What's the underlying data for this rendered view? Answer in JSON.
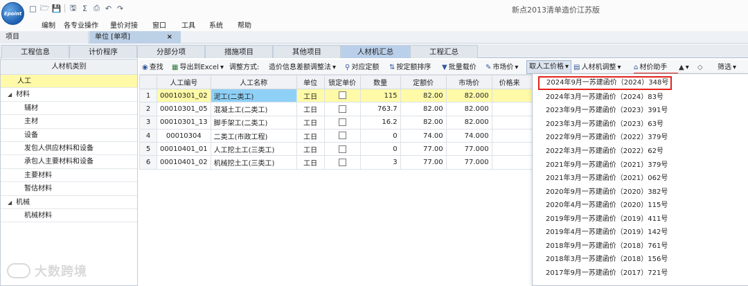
{
  "logo_text": "Epoint",
  "app_title": "新点2013清单造价江苏版",
  "menu": [
    "编制",
    "各专业操作",
    "量价对接",
    "窗口",
    "工具",
    "系统",
    "帮助"
  ],
  "doc_tabs": {
    "project": "项目",
    "unit": "单位 [单项]",
    "close": "×"
  },
  "feature_tabs": [
    "工程信息",
    "计价程序",
    "分部分项",
    "措施项目",
    "其他项目",
    "人材机汇总",
    "工程汇总"
  ],
  "left_panel": {
    "header": "人材机类别",
    "items": [
      {
        "label": "人工",
        "level": 0,
        "selected": true
      },
      {
        "label": "材料",
        "level": -1,
        "expanded": true
      },
      {
        "label": "辅材",
        "level": 1
      },
      {
        "label": "主材",
        "level": 1
      },
      {
        "label": "设备",
        "level": 1
      },
      {
        "label": "发包人供应材料和设备",
        "level": 1
      },
      {
        "label": "承包人主要材料和设备",
        "level": 1
      },
      {
        "label": "主要材料",
        "level": 1
      },
      {
        "label": "暂估材料",
        "level": 1
      },
      {
        "label": "机械",
        "level": -1,
        "expanded": true
      },
      {
        "label": "机械材料",
        "level": 1
      }
    ]
  },
  "toolbar": {
    "find": "查找",
    "export": "导出到Excel",
    "adjust_label": "调整方式:",
    "adjust_value": "造价信息差额调整法",
    "match_quota": "对应定额",
    "sort_quota": "按定额排序",
    "batch_price": "批量载价",
    "market_price": "市场价",
    "labor_price": "取人工价格",
    "rcj_adjust": "人材机调整",
    "price_helper": "材价助手",
    "filter": "筛选"
  },
  "grid": {
    "headers": [
      "",
      "人工编号",
      "人工名称",
      "单位",
      "锁定单价",
      "数量",
      "定额价",
      "市场价",
      "价格来"
    ],
    "rows": [
      {
        "no": "1",
        "code": "00010301_02",
        "name": "泥工(二类工)",
        "unit": "工日",
        "qty": "115",
        "quota": "82.00",
        "market": "82.000"
      },
      {
        "no": "2",
        "code": "00010301_05",
        "name": "混凝土工(二类工)",
        "unit": "工日",
        "qty": "763.7",
        "quota": "82.00",
        "market": "82.000"
      },
      {
        "no": "3",
        "code": "00010301_13",
        "name": "脚手架工(二类工)",
        "unit": "工日",
        "qty": "16.2",
        "quota": "82.00",
        "market": "82.000"
      },
      {
        "no": "4",
        "code": "00010304",
        "name": "二类工(市政工程)",
        "unit": "工日",
        "qty": "0",
        "quota": "74.00",
        "market": "74.000"
      },
      {
        "no": "5",
        "code": "00010401_01",
        "name": "人工挖土工(三类工)",
        "unit": "工日",
        "qty": "0",
        "quota": "77.00",
        "market": "77.000"
      },
      {
        "no": "6",
        "code": "00010401_02",
        "name": "机械挖土工(三类工)",
        "unit": "工日",
        "qty": "3",
        "quota": "77.00",
        "market": "77.000"
      }
    ]
  },
  "dropdown": {
    "items": [
      "2024年9月一苏建函价（2024）348号",
      "2024年3月一苏建函价（2024）83号",
      "2023年9月一苏建函价（2023）391号",
      "2023年3月一苏建函价（2023）63号",
      "2022年9月一苏建函价（2022）379号",
      "2022年3月一苏建函价（2022）62号",
      "2021年9月一苏建函价（2021）379号",
      "2021年3月一苏建函价（2021）062号",
      "2020年9月一苏建函价（2020）382号",
      "2020年4月一苏建函价（2020）115号",
      "2019年9月一苏建函价（2019）411号",
      "2019年4月一苏建函价（2019）142号",
      "2018年9月一苏建函价（2018）761号",
      "2018年3月一苏建函价（2018）156号",
      "2017年9月一苏建函价（2017）721号"
    ]
  },
  "watermark": "大数跨境"
}
